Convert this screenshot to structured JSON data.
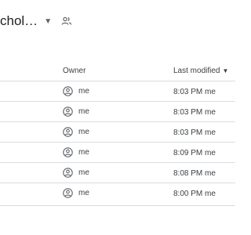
{
  "folder": {
    "title": "chol…",
    "dropdown_icon": "dropdown-triangle-icon",
    "shared_icon": "people-icon"
  },
  "table": {
    "columns": {
      "owner": "Owner",
      "last_modified": "Last modified"
    },
    "sort_icon": "arrow-down-icon",
    "rows": [
      {
        "owner": "me",
        "modified": "8:03 PM me"
      },
      {
        "owner": "me",
        "modified": "8:03 PM me"
      },
      {
        "owner": "me",
        "modified": "8:03 PM me"
      },
      {
        "owner": "me",
        "modified": "8:09 PM me"
      },
      {
        "owner": "me",
        "modified": "8:08 PM me"
      },
      {
        "owner": "me",
        "modified": "8:00 PM me"
      }
    ]
  },
  "colors": {
    "text": "#202124",
    "secondary": "#5f6368",
    "divider": "#dadce0"
  }
}
